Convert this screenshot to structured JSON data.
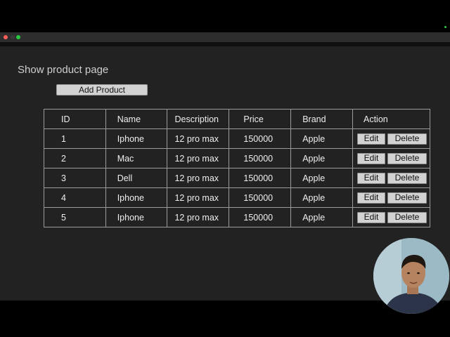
{
  "window": {
    "controls": {
      "close_color": "#ff5f57",
      "minimize_color": "#3a3a3a",
      "maximize_color": "#28c840"
    },
    "indicator_color": "#2ecc40"
  },
  "page": {
    "title": "Show product page",
    "add_button_label": "Add Product"
  },
  "table": {
    "headers": [
      "ID",
      "Name",
      "Description",
      "Price",
      "Brand",
      "Action"
    ],
    "rows": [
      {
        "id": "1",
        "name": "Iphone",
        "description": "12 pro max",
        "price": "150000",
        "brand": "Apple"
      },
      {
        "id": "2",
        "name": "Mac",
        "description": "12 pro max",
        "price": "150000",
        "brand": "Apple"
      },
      {
        "id": "3",
        "name": "Dell",
        "description": "12 pro max",
        "price": "150000",
        "brand": "Apple"
      },
      {
        "id": "4",
        "name": "Iphone",
        "description": "12 pro max",
        "price": "150000",
        "brand": "Apple"
      },
      {
        "id": "5",
        "name": "Iphone",
        "description": "12 pro max",
        "price": "150000",
        "brand": "Apple"
      }
    ],
    "edit_label": "Edit",
    "delete_label": "Delete"
  },
  "colors": {
    "page_background": "#222222",
    "button_background": "#d2d2d2",
    "border": "#9a9a9a"
  }
}
